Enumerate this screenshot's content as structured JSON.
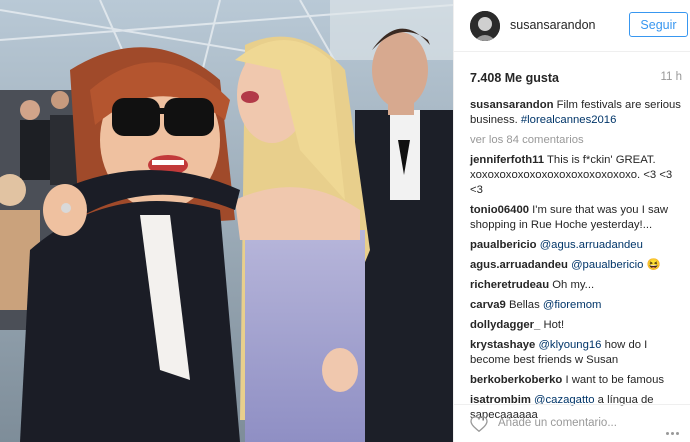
{
  "post": {
    "username": "susansarandon",
    "follow_label": "Seguir",
    "likes": "7.408 Me gusta",
    "time": "11 h",
    "caption_author": "susansarandon",
    "caption_text": "Film festivals are serious business.",
    "caption_tag": "#lorealcannes2016",
    "view_all": "ver los 84 comentarios",
    "add_comment_placeholder": "Añade un comentario..."
  },
  "comments": [
    {
      "author": "jenniferfoth11",
      "text": "This is f*ckin' GREAT. xoxoxoxoxoxoxoxoxoxoxoxoxoxo. <3 <3 <3",
      "mention": ""
    },
    {
      "author": "tonio06400",
      "text": "I'm sure that was you I saw shopping in Rue Hoche yesterday!...",
      "mention": ""
    },
    {
      "author": "paualbericio",
      "text": "",
      "mention": "@agus.arruadandeu"
    },
    {
      "author": "agus.arruadandeu",
      "text": "",
      "mention": "@paualbericio 😆"
    },
    {
      "author": "richeretrudeau",
      "text": "Oh my...",
      "mention": ""
    },
    {
      "author": "carva9",
      "text": "Bellas",
      "mention": "@fioremom"
    },
    {
      "author": "dollydagger_",
      "text": "Hot!",
      "mention": ""
    },
    {
      "author": "krystashaye",
      "text": "how do I become best friends w Susan",
      "mention": "@klyoung16"
    },
    {
      "author": "berkoberkoberko",
      "text": "I want to be famous",
      "mention": ""
    },
    {
      "author": "isatrombim",
      "text": "a língua de sapecaaaaaa",
      "mention": "@cazagatto"
    }
  ],
  "icons": {
    "heart": "heart-icon",
    "more": "more-options-icon"
  },
  "colors": {
    "accent": "#3897f0",
    "mention": "#003569",
    "muted": "#999999"
  }
}
